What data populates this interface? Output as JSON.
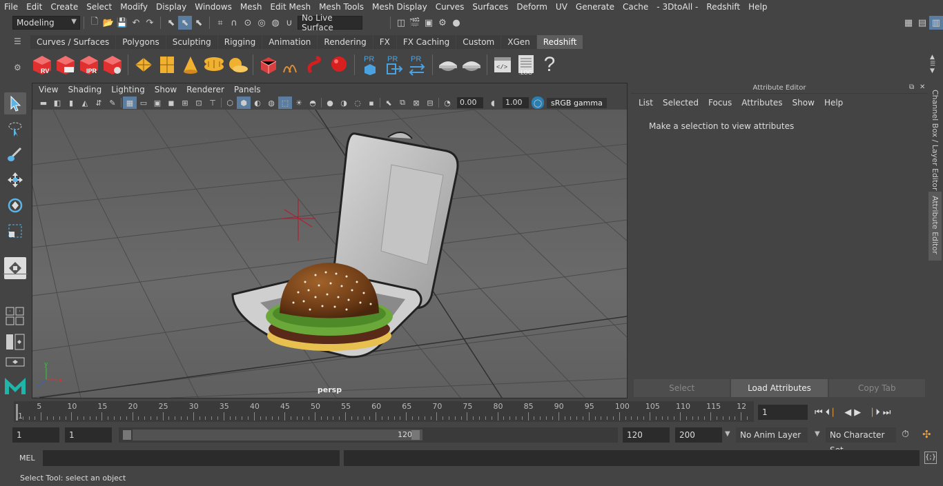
{
  "menubar": [
    "File",
    "Edit",
    "Create",
    "Select",
    "Modify",
    "Display",
    "Windows",
    "Mesh",
    "Edit Mesh",
    "Mesh Tools",
    "Mesh Display",
    "Curves",
    "Surfaces",
    "Deform",
    "UV",
    "Generate",
    "Cache",
    "- 3DtoAll -",
    "Redshift",
    "Help"
  ],
  "status": {
    "mode": "Modeling",
    "live_surface": "No Live Surface"
  },
  "shelf_tabs": [
    "Curves / Surfaces",
    "Polygons",
    "Sculpting",
    "Rigging",
    "Animation",
    "Rendering",
    "FX",
    "FX Caching",
    "Custom",
    "XGen",
    "Redshift"
  ],
  "shelf_active": "Redshift",
  "shelf_labels": {
    "rv": "RV",
    "ipr": "IPR",
    "pr1": "PR",
    "pr2": "PR",
    "pr3": "PR",
    "log": ".LOG"
  },
  "viewport": {
    "menus": [
      "View",
      "Shading",
      "Lighting",
      "Show",
      "Renderer",
      "Panels"
    ],
    "gamma": "sRGB gamma",
    "exposure": "0.00",
    "gamma_val": "1.00",
    "camera": "persp"
  },
  "attribute_editor": {
    "title": "Attribute Editor",
    "menus": [
      "List",
      "Selected",
      "Focus",
      "Attributes",
      "Show",
      "Help"
    ],
    "message": "Make a selection to view attributes",
    "buttons": [
      "Select",
      "Load Attributes",
      "Copy Tab"
    ]
  },
  "side_tabs": [
    "Channel Box / Layer Editor",
    "Attribute Editor"
  ],
  "timeline": {
    "ticks": [
      "1",
      "5",
      "10",
      "15",
      "20",
      "25",
      "30",
      "35",
      "40",
      "45",
      "50",
      "55",
      "60",
      "65",
      "70",
      "75",
      "80",
      "85",
      "90",
      "95",
      "100",
      "105",
      "110",
      "115",
      "12"
    ],
    "current": "1"
  },
  "range": {
    "start": "1",
    "start2": "1",
    "slider_start": "1",
    "slider_end": "120",
    "end": "120",
    "end2": "200",
    "anim_layer": "No Anim Layer",
    "char_set": "No Character Set"
  },
  "cmd": {
    "label": "MEL"
  },
  "help": "Select Tool: select an object"
}
